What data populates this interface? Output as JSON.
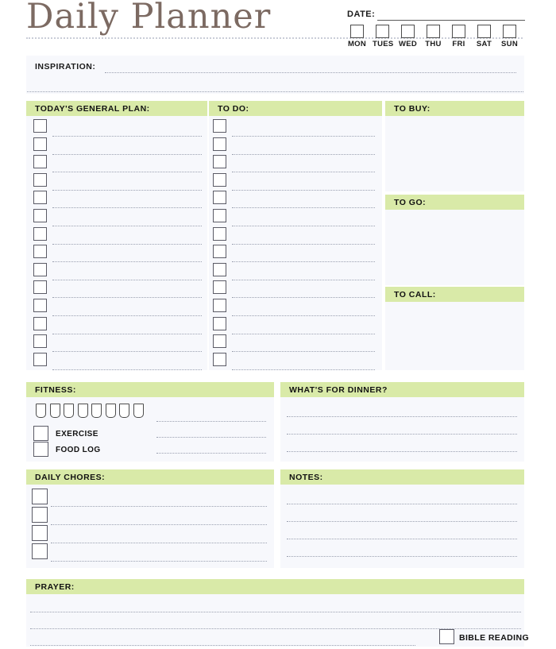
{
  "document": {
    "title": "Daily Planner"
  },
  "header": {
    "date_label": "DATE:",
    "days": [
      {
        "label": "MON"
      },
      {
        "label": "TUES"
      },
      {
        "label": "WED"
      },
      {
        "label": "THU"
      },
      {
        "label": "FRI"
      },
      {
        "label": "SAT"
      },
      {
        "label": "SUN"
      }
    ]
  },
  "inspiration": {
    "label": "INSPIRATION:",
    "value": ""
  },
  "sections": {
    "general_plan": {
      "label": "TODAY'S GENERAL PLAN:",
      "rows": 14,
      "values": []
    },
    "to_do": {
      "label": "TO DO:",
      "rows": 14,
      "values": []
    },
    "to_buy": {
      "label": "TO BUY:",
      "value": ""
    },
    "to_go": {
      "label": "TO GO:",
      "value": ""
    },
    "to_call": {
      "label": "TO CALL:",
      "value": ""
    },
    "fitness": {
      "label": "FITNESS:",
      "water_glasses": 8,
      "checkboxes": [
        {
          "label": "EXERCISE"
        },
        {
          "label": "FOOD LOG"
        }
      ],
      "lines": 3
    },
    "dinner": {
      "label": "WHAT'S FOR DINNER?",
      "lines": 3,
      "values": []
    },
    "daily_chores": {
      "label": "DAILY CHORES:",
      "rows": 4,
      "values": []
    },
    "notes": {
      "label": "NOTES:",
      "lines": 4,
      "values": []
    },
    "prayer": {
      "label": "PRAYER:",
      "lines": 3,
      "values": []
    },
    "bible_reading": {
      "label": "BIBLE READING"
    }
  },
  "colors": {
    "accent_green": "#d9eaa8",
    "panel_bg": "#f7f8fc",
    "title_brown": "#7c6a62",
    "ink": "#121212",
    "rule": "#9aa0b0"
  }
}
